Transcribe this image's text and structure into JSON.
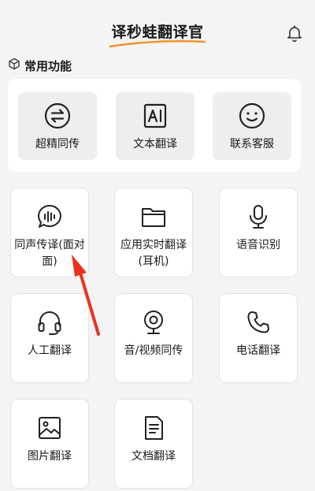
{
  "header": {
    "title": "译秒蛙翻译官"
  },
  "section": {
    "title": "常用功能"
  },
  "top_features": [
    {
      "label": "超精同传",
      "icon": "swap-arrows-icon"
    },
    {
      "label": "文本翻译",
      "icon": "text-ai-icon"
    },
    {
      "label": "联系客服",
      "icon": "smiley-icon"
    }
  ],
  "tiles": [
    {
      "label": "同声传译(面对面)",
      "icon": "voice-wave-bubble-icon"
    },
    {
      "label": "应用实时翻译(耳机)",
      "icon": "folder-icon"
    },
    {
      "label": "语音识别",
      "icon": "microphone-icon"
    },
    {
      "label": "人工翻译",
      "icon": "headset-icon"
    },
    {
      "label": "音/视频同传",
      "icon": "webcam-icon"
    },
    {
      "label": "电话翻译",
      "icon": "phone-icon"
    },
    {
      "label": "图片翻译",
      "icon": "image-icon"
    },
    {
      "label": "文档翻译",
      "icon": "document-icon"
    }
  ],
  "colors": {
    "accent": "#f0922b",
    "annotation": "#e8321e",
    "background": "#f4f4f5"
  }
}
